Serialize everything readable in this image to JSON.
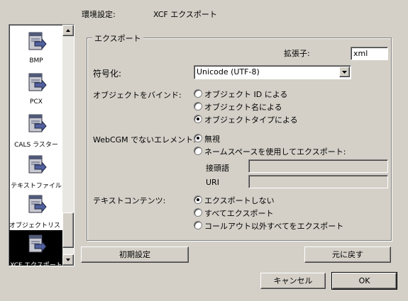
{
  "header": {
    "title": "環境設定:",
    "page": "XCF エクスポート"
  },
  "sidebar": {
    "items": [
      {
        "label": "BMP",
        "icon": "bmp-export-icon"
      },
      {
        "label": "PCX",
        "icon": "pcx-export-icon"
      },
      {
        "label": "CALS ラスター",
        "icon": "cals-raster-icon"
      },
      {
        "label": "テキストファイル",
        "icon": "text-file-icon"
      },
      {
        "label": "オブジェクトリスト",
        "icon": "object-list-icon"
      },
      {
        "label": "XCF エクスポート",
        "icon": "xcf-export-icon",
        "selected": true
      }
    ]
  },
  "export_group": {
    "title": "エクスポート",
    "extension_label": "拡張子:",
    "extension_value": "xml",
    "encoding_label": "符号化:",
    "encoding_value": "Unicode (UTF-8)",
    "bind_label": "オブジェクトをバインド:",
    "bind_options": [
      {
        "label": "オブジェクト ID による",
        "checked": false
      },
      {
        "label": "オブジェクト名による",
        "checked": false
      },
      {
        "label": "オブジェクトタイプによる",
        "checked": true
      }
    ],
    "nonwebcgm_label": "WebCGM でないエレメント:",
    "nonwebcgm_options": [
      {
        "label": "無視",
        "checked": true
      },
      {
        "label": "ネームスペースを使用してエクスポート:",
        "checked": false
      }
    ],
    "prefix_label": "接頭語",
    "prefix_value": "",
    "uri_label": "URI",
    "uri_value": "",
    "text_label": "テキストコンテンツ:",
    "text_options": [
      {
        "label": "エクスポートしない",
        "checked": true
      },
      {
        "label": "すべてエクスポート",
        "checked": false
      },
      {
        "label": "コールアウト以外すべてをエクスポート",
        "checked": false
      }
    ]
  },
  "buttons": {
    "defaults": "初期設定",
    "revert": "元に戻す",
    "cancel": "キャンセル",
    "ok": "OK"
  }
}
